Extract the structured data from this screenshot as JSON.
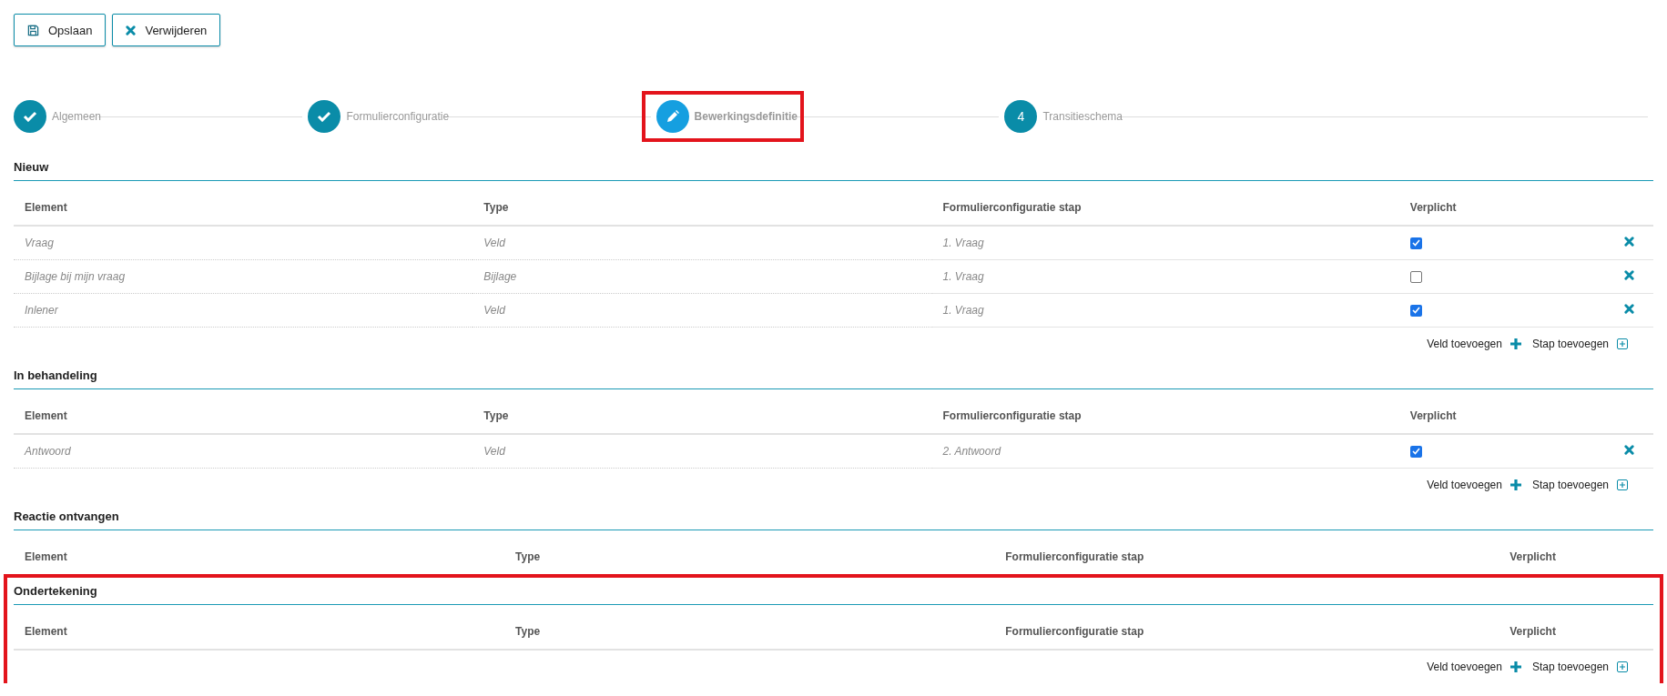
{
  "toolbar": {
    "buttons": [
      {
        "label": "Opslaan",
        "kind": "save"
      },
      {
        "label": "Verwijderen",
        "kind": "delete"
      }
    ]
  },
  "steps": [
    {
      "label": "Algemeen",
      "kind": "done",
      "highlighted": false
    },
    {
      "label": "Formulierconfiguratie",
      "kind": "done",
      "highlighted": false
    },
    {
      "label": "Bewerkingsdefinitie",
      "kind": "current",
      "highlighted": true
    },
    {
      "label": "Transitieschema",
      "kind": "todo",
      "number": "4",
      "highlighted": false
    }
  ],
  "sections": [
    {
      "title": "Nieuw",
      "highlighted": false,
      "columns": [
        "Element",
        "Type",
        "Formulierconfiguratie stap",
        "Verplicht"
      ],
      "rows": [
        {
          "element": "Vraag",
          "type": "Veld",
          "step": "1. Vraag",
          "required": true
        },
        {
          "element": "Bijlage bij mijn vraag",
          "type": "Bijlage",
          "step": "1. Vraag",
          "required": false
        },
        {
          "element": "Inlener",
          "type": "Veld",
          "step": "1. Vraag",
          "required": true
        }
      ],
      "actions": [
        {
          "label": "Veld toevoegen",
          "kind": "add-field"
        },
        {
          "label": "Stap toevoegen",
          "kind": "add-step"
        }
      ]
    },
    {
      "title": "In behandeling",
      "highlighted": false,
      "columns": [
        "Element",
        "Type",
        "Formulierconfiguratie stap",
        "Verplicht"
      ],
      "rows": [
        {
          "element": "Antwoord",
          "type": "Veld",
          "step": "2. Antwoord",
          "required": true
        }
      ],
      "actions": [
        {
          "label": "Veld toevoegen",
          "kind": "add-field"
        },
        {
          "label": "Stap toevoegen",
          "kind": "add-step"
        }
      ]
    },
    {
      "title": "Reactie ontvangen",
      "highlighted": false,
      "columns": [
        "Element",
        "Type",
        "Formulierconfiguratie stap",
        "Verplicht"
      ]
    },
    {
      "title": "Ondertekening",
      "highlighted": true,
      "columns": [
        "Element",
        "Type",
        "Formulierconfiguratie stap",
        "Verplicht"
      ],
      "actions": [
        {
          "label": "Veld toevoegen",
          "kind": "add-field"
        },
        {
          "label": "Stap toevoegen",
          "kind": "add-step"
        }
      ]
    }
  ]
}
